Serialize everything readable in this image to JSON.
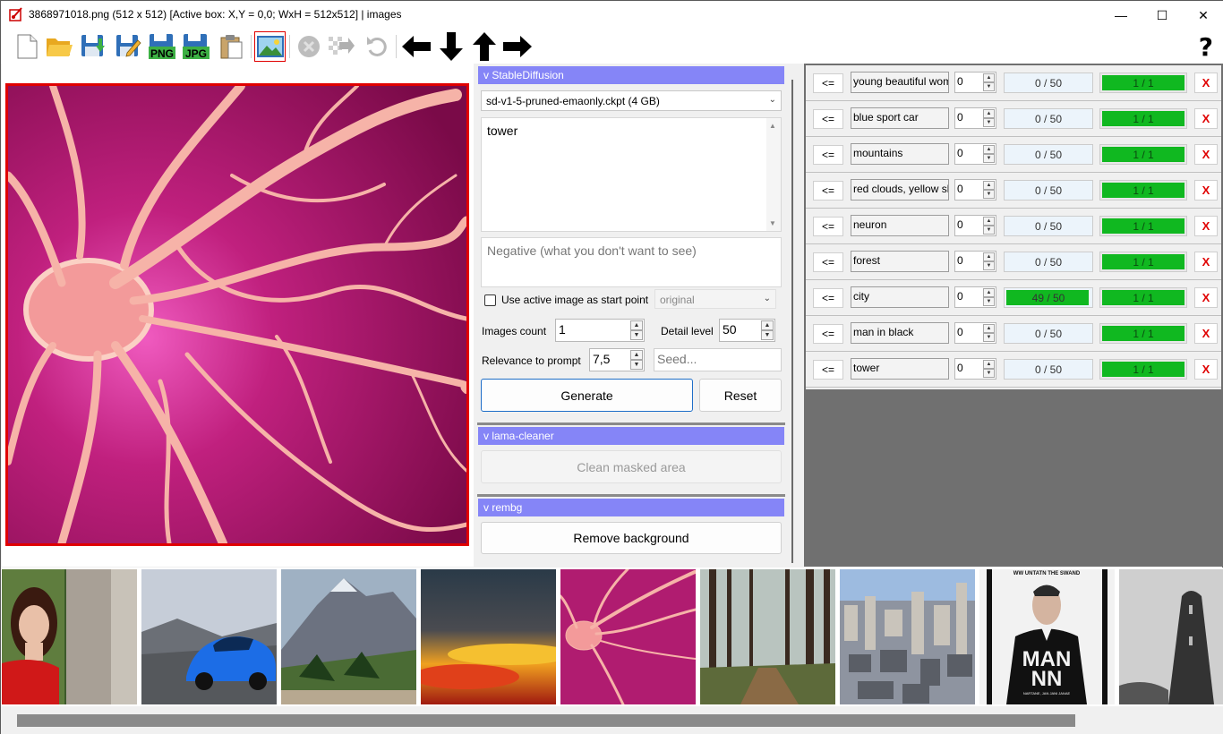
{
  "window": {
    "title": "3868971018.png (512 x 512) [Active box: X,Y = 0,0; WxH = 512x512] | images",
    "minimize": "—",
    "maximize": "☐",
    "close": "✕"
  },
  "toolbar": {
    "help": "?",
    "png_label": "PNG",
    "jpg_label": "JPG",
    "items": [
      "new-file-icon",
      "open-folder-icon",
      "save-icon",
      "save-as-icon",
      "save-png-icon",
      "save-jpg-icon",
      "clipboard-icon",
      "image-icon",
      "cancel-icon",
      "checker-arrow-icon",
      "undo-icon",
      "arrow-left-icon",
      "arrow-down-icon",
      "arrow-up-icon",
      "arrow-right-icon"
    ]
  },
  "stable_diffusion": {
    "header": "v StableDiffusion",
    "model": "sd-v1-5-pruned-emaonly.ckpt (4 GB)",
    "prompt": "tower",
    "negative_placeholder": "Negative (what you don't want to see)",
    "use_active_image_label": "Use active image as start point",
    "use_active_image_checked": false,
    "start_mode": "original",
    "images_count_label": "Images count",
    "images_count": "1",
    "detail_level_label": "Detail level",
    "detail_level": "50",
    "relevance_label": "Relevance to prompt",
    "relevance": "7,5",
    "seed_placeholder": "Seed...",
    "generate": "Generate",
    "reset": "Reset"
  },
  "lama_cleaner": {
    "header": "v lama-cleaner",
    "clean": "Clean masked area"
  },
  "rembg": {
    "header": "v rembg",
    "remove": "Remove background"
  },
  "queue": [
    {
      "back": "<=",
      "prompt": "young beautiful woman",
      "count": "0",
      "progress": "0 / 50",
      "progress_fraction": 0,
      "done": "1 / 1",
      "delete": "X"
    },
    {
      "back": "<=",
      "prompt": "blue sport car",
      "count": "0",
      "progress": "0 / 50",
      "progress_fraction": 0,
      "done": "1 / 1",
      "delete": "X"
    },
    {
      "back": "<=",
      "prompt": "mountains",
      "count": "0",
      "progress": "0 / 50",
      "progress_fraction": 0,
      "done": "1 / 1",
      "delete": "X"
    },
    {
      "back": "<=",
      "prompt": "red clouds, yellow sky",
      "count": "0",
      "progress": "0 / 50",
      "progress_fraction": 0,
      "done": "1 / 1",
      "delete": "X"
    },
    {
      "back": "<=",
      "prompt": "neuron",
      "count": "0",
      "progress": "0 / 50",
      "progress_fraction": 0,
      "done": "1 / 1",
      "delete": "X"
    },
    {
      "back": "<=",
      "prompt": "forest",
      "count": "0",
      "progress": "0 / 50",
      "progress_fraction": 0,
      "done": "1 / 1",
      "delete": "X"
    },
    {
      "back": "<=",
      "prompt": "city",
      "count": "0",
      "progress": "49 / 50",
      "progress_fraction": 0.98,
      "done": "1 / 1",
      "delete": "X"
    },
    {
      "back": "<=",
      "prompt": "man in black",
      "count": "0",
      "progress": "0 / 50",
      "progress_fraction": 0,
      "done": "1 / 1",
      "delete": "X"
    },
    {
      "back": "<=",
      "prompt": "tower",
      "count": "0",
      "progress": "0 / 50",
      "progress_fraction": 0,
      "done": "1 / 1",
      "delete": "X"
    }
  ],
  "thumbnails": [
    "woman-in-red",
    "blue-sport-car",
    "mountains",
    "red-clouds-yellow-sky",
    "neuron",
    "forest",
    "city",
    "man-in-black-poster",
    "tower"
  ],
  "poster": {
    "top_text": "WW UNTATN THE SWAND",
    "title_1": "MAN",
    "title_2": "NN",
    "bottom_text": "NARTANE, JAN JANI JANAE"
  },
  "colors": {
    "accent_header": "#8585f7",
    "progress_green": "#10b820",
    "delete_red": "#e00000",
    "active_border": "#e00000"
  }
}
